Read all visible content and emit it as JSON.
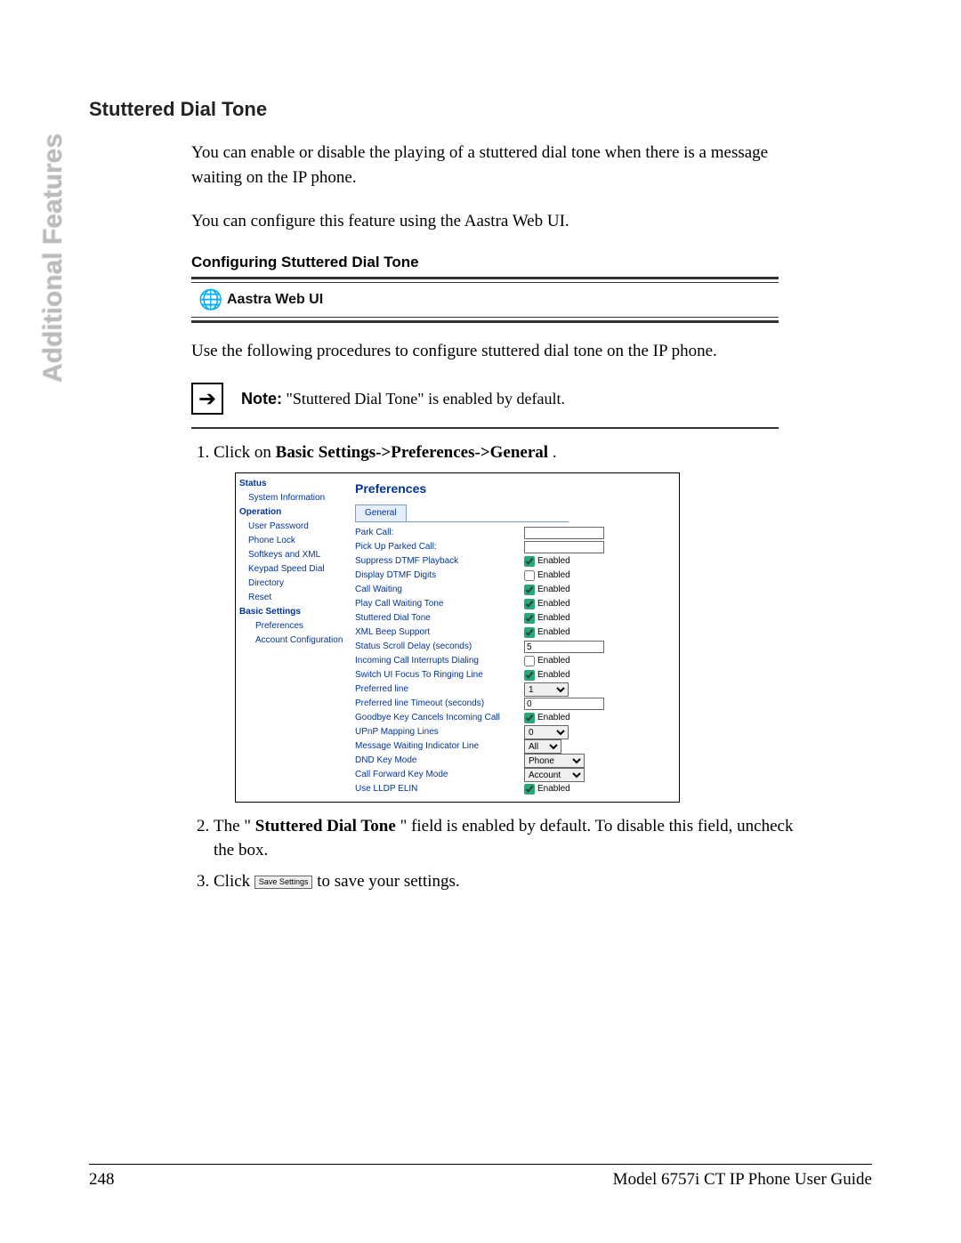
{
  "side_label": "Additional Features",
  "section_title": "Stuttered Dial Tone",
  "paragraphs": {
    "p1": "You can enable or disable the playing of a stuttered dial tone when there is a message waiting on the IP phone.",
    "p2": "You can configure this feature using the Aastra Web UI."
  },
  "sub_heading": "Configuring Stuttered Dial Tone",
  "callout": {
    "icon_name": "globe-icon",
    "label": "Aastra Web UI"
  },
  "use_text": "Use the following procedures to configure stuttered dial tone on the IP phone.",
  "note": {
    "label": "Note:",
    "text": " \"Stuttered Dial Tone\" is enabled by default."
  },
  "steps": {
    "s1": {
      "prefix": "Click on ",
      "bold": "Basic Settings->Preferences->General",
      "suffix": "."
    },
    "s2": {
      "prefix": "The \"",
      "bold": "Stuttered Dial Tone",
      "suffix": "\" field is enabled by default. To disable this field, uncheck the box."
    },
    "s3": {
      "prefix": "Click  ",
      "btn": "Save Settings",
      "suffix": " to save your settings."
    }
  },
  "nav": {
    "status": "Status",
    "system_info": "System Information",
    "operation": "Operation",
    "user_password": "User Password",
    "phone_lock": "Phone Lock",
    "softkeys_xml": "Softkeys and XML",
    "keypad_speed": "Keypad Speed Dial",
    "directory": "Directory",
    "reset": "Reset",
    "basic_settings": "Basic Settings",
    "preferences": "Preferences",
    "account_config": "Account Configuration"
  },
  "panel": {
    "title": "Preferences",
    "tab": "General",
    "rows": {
      "park_call": {
        "label": "Park Call:",
        "type": "text",
        "value": ""
      },
      "pickup_parked": {
        "label": "Pick Up Parked Call:",
        "type": "text",
        "value": ""
      },
      "suppress_dtmf": {
        "label": "Suppress DTMF Playback",
        "type": "check",
        "checked": true
      },
      "display_dtmf": {
        "label": "Display DTMF Digits",
        "type": "check",
        "checked": false
      },
      "call_waiting": {
        "label": "Call Waiting",
        "type": "check",
        "checked": true
      },
      "play_cw_tone": {
        "label": "Play Call Waiting Tone",
        "type": "check",
        "checked": true
      },
      "stuttered": {
        "label": "Stuttered Dial Tone",
        "type": "check",
        "checked": true
      },
      "xml_beep": {
        "label": "XML Beep Support",
        "type": "check",
        "checked": true
      },
      "scroll_delay": {
        "label": "Status Scroll Delay (seconds)",
        "type": "text",
        "value": "5"
      },
      "incoming_interrupt": {
        "label": "Incoming Call Interrupts Dialing",
        "type": "check",
        "checked": false
      },
      "switch_focus": {
        "label": "Switch UI Focus To Ringing Line",
        "type": "check",
        "checked": true
      },
      "pref_line": {
        "label": "Preferred line",
        "type": "select",
        "value": "1"
      },
      "pref_line_timeout": {
        "label": "Preferred line Timeout (seconds)",
        "type": "text",
        "value": "0"
      },
      "goodbye_cancel": {
        "label": "Goodbye Key Cancels Incoming Call",
        "type": "check",
        "checked": true
      },
      "upnp": {
        "label": "UPnP Mapping Lines",
        "type": "select",
        "value": "0"
      },
      "mwi_line": {
        "label": "Message Waiting Indicator Line",
        "type": "select",
        "value": "All"
      },
      "dnd_mode": {
        "label": "DND Key Mode",
        "type": "select",
        "value": "Phone"
      },
      "cfwd_mode": {
        "label": "Call Forward Key Mode",
        "type": "select",
        "value": "Account"
      },
      "lldp": {
        "label": "Use LLDP ELIN",
        "type": "check",
        "checked": true
      }
    },
    "enabled_label": "Enabled"
  },
  "footer": {
    "page_no": "248",
    "guide": "Model 6757i CT IP Phone User Guide"
  }
}
